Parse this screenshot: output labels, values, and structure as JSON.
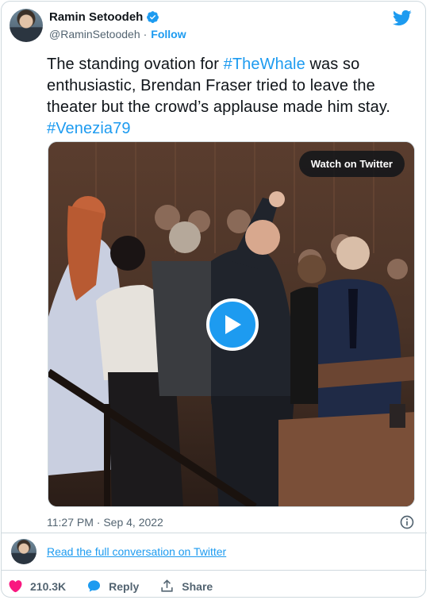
{
  "author": {
    "display_name": "Ramin Setoodeh",
    "handle": "@RaminSetoodeh",
    "separator": "·",
    "follow_label": "Follow",
    "verified": true
  },
  "tweet": {
    "text_before": "The standing ovation for ",
    "hashtag1": "#TheWhale",
    "text_middle": " was so enthusiastic, Brendan Fraser tried to leave the theater but the crowd’s applause made him stay. ",
    "hashtag2": "#Venezia79"
  },
  "media": {
    "watch_label": "Watch on Twitter",
    "play_icon": "play-icon"
  },
  "meta": {
    "timestamp": "11:27 PM · Sep 4, 2022"
  },
  "conversation": {
    "link_label": "Read the full conversation on Twitter"
  },
  "actions": {
    "like_count": "210.3K",
    "reply_label": "Reply",
    "share_label": "Share"
  },
  "colors": {
    "accent": "#1d9bf0",
    "text": "#0f1419",
    "muted": "#536471",
    "like": "#f91880",
    "border": "#cfd9de"
  }
}
